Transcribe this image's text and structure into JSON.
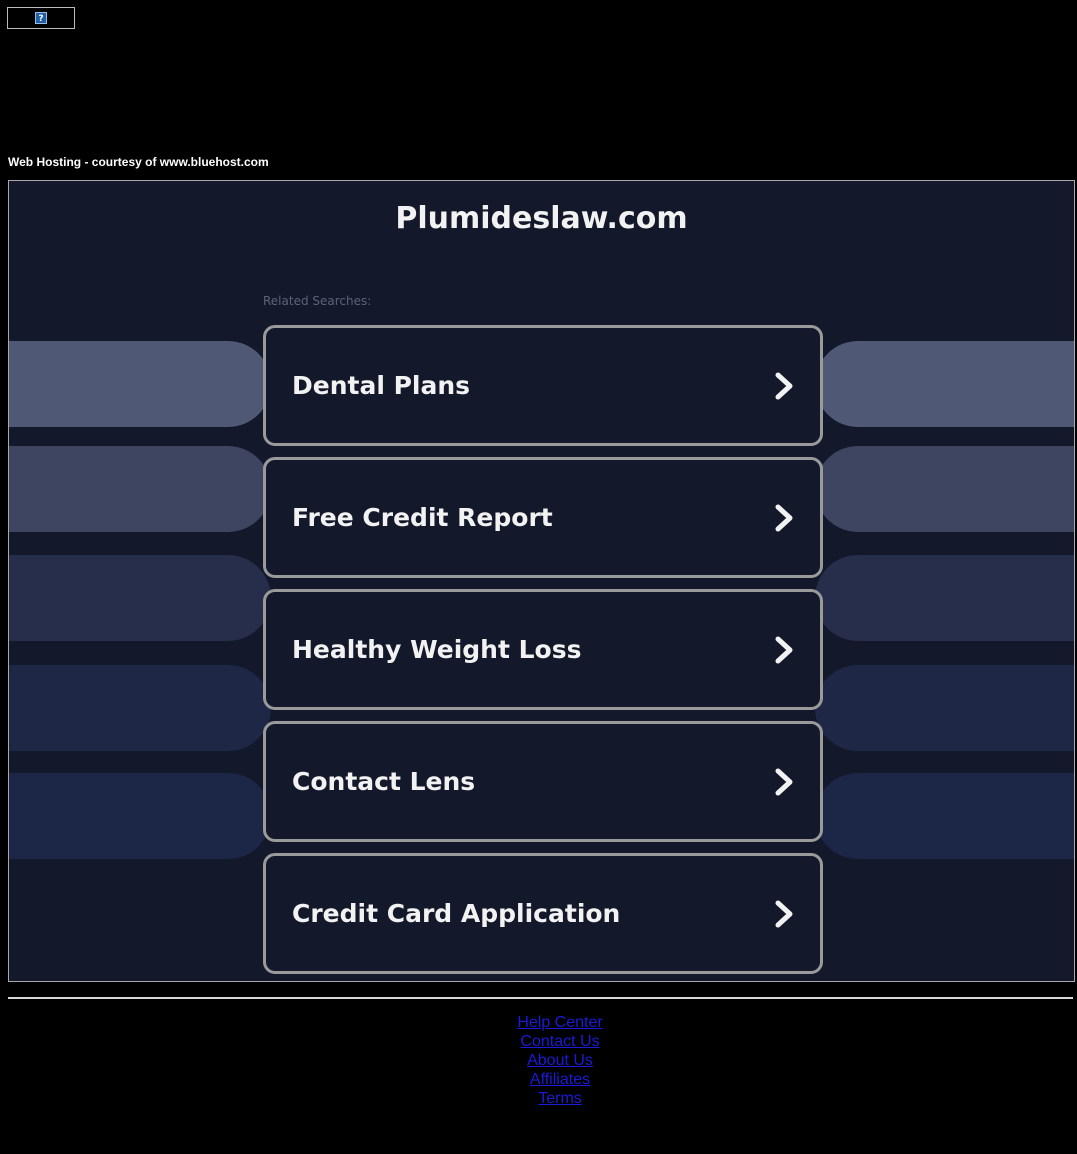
{
  "banner": {
    "icon": "question-mark-icon",
    "glyph": "?"
  },
  "courtesy_text": "Web Hosting - courtesy of www.bluehost.com",
  "site_title": "Plumideslaw.com",
  "related_label": "Related Searches:",
  "searches": [
    {
      "label": "Dental Plans",
      "icon": "chevron-right-icon"
    },
    {
      "label": "Free Credit Report",
      "icon": "chevron-right-icon"
    },
    {
      "label": "Healthy Weight Loss",
      "icon": "chevron-right-icon"
    },
    {
      "label": "Contact Lens",
      "icon": "chevron-right-icon"
    },
    {
      "label": "Credit Card Application",
      "icon": "chevron-right-icon"
    }
  ],
  "footer": {
    "links": [
      "Help Center",
      "Contact Us",
      "About Us",
      "Affiliates",
      "Terms"
    ]
  },
  "colors": {
    "page_background": "#000000",
    "panel_background": "#13182b",
    "card_border": "#9a9a9a",
    "link": "#1b1bd6"
  }
}
